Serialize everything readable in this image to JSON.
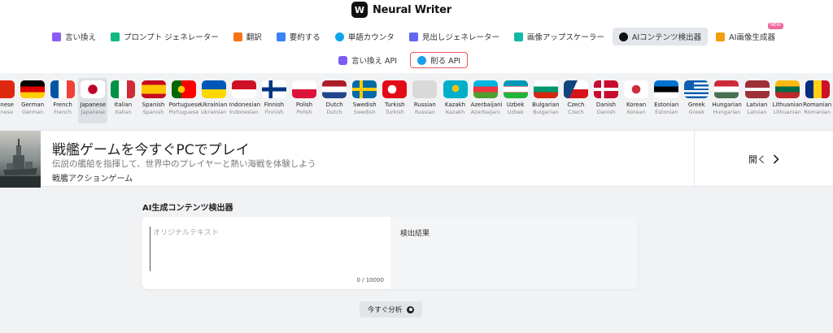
{
  "brand": {
    "name": "Neural Writer",
    "logo_text": "W"
  },
  "nav": {
    "items": [
      {
        "label": "言い換え",
        "icon": "paraphrase-icon",
        "color": "#8b5cf6"
      },
      {
        "label": "プロンプト ジェネレーター",
        "icon": "prompt-icon",
        "color": "#10b981"
      },
      {
        "label": "翻訳",
        "icon": "translate-icon",
        "color": "#f97316"
      },
      {
        "label": "要約する",
        "icon": "summarize-icon",
        "color": "#3b82f6"
      },
      {
        "label": "単語カウンタ",
        "icon": "word-counter-icon",
        "color": "#0ea5e9"
      },
      {
        "label": "見出しジェネレーター",
        "icon": "headline-icon",
        "color": "#6366f1"
      },
      {
        "label": "画像アップスケーラー",
        "icon": "upscaler-icon",
        "color": "#14b8a6"
      },
      {
        "label": "AIコンテンツ検出器",
        "icon": "ai-detector-icon",
        "color": "#111111",
        "active": true
      },
      {
        "label": "AI画像生成器",
        "icon": "image-generator-icon",
        "color": "#f59e0b",
        "badge": "NEW"
      }
    ]
  },
  "api": {
    "paraphrase_api": "言い換え API",
    "delete_api": "削る API"
  },
  "languages": [
    {
      "name": "Chinese",
      "native": "Chinese",
      "flag": "cn"
    },
    {
      "name": "German",
      "native": "German",
      "flag": "de"
    },
    {
      "name": "French",
      "native": "French",
      "flag": "fr"
    },
    {
      "name": "Japanese",
      "native": "Japanese",
      "flag": "jp",
      "selected": true
    },
    {
      "name": "Italian",
      "native": "Italian",
      "flag": "it"
    },
    {
      "name": "Spanish",
      "native": "Spanish",
      "flag": "es"
    },
    {
      "name": "Portuguese",
      "native": "Portuguese",
      "flag": "pt"
    },
    {
      "name": "Ukrainian",
      "native": "Ukrainian",
      "flag": "ua"
    },
    {
      "name": "Indonesian",
      "native": "Indonesian",
      "flag": "id"
    },
    {
      "name": "Finnish",
      "native": "Finnish",
      "flag": "fi"
    },
    {
      "name": "Polish",
      "native": "Polish",
      "flag": "pl"
    },
    {
      "name": "Dutch",
      "native": "Dutch",
      "flag": "nl"
    },
    {
      "name": "Swedish",
      "native": "Swedish",
      "flag": "se"
    },
    {
      "name": "Turkish",
      "native": "Turkish",
      "flag": "tr"
    },
    {
      "name": "Russian",
      "native": "Russian",
      "flag": "ru"
    },
    {
      "name": "Kazakh",
      "native": "Kazakh",
      "flag": "kz"
    },
    {
      "name": "Azerbaijani",
      "native": "Azerbaijani",
      "flag": "az"
    },
    {
      "name": "Uzbek",
      "native": "Uzbek",
      "flag": "uz"
    },
    {
      "name": "Bulgarian",
      "native": "Bulgarian",
      "flag": "bg"
    },
    {
      "name": "Czech",
      "native": "Czech",
      "flag": "cz"
    },
    {
      "name": "Danish",
      "native": "Danish",
      "flag": "dk"
    },
    {
      "name": "Korean",
      "native": "Korean",
      "flag": "kr"
    },
    {
      "name": "Estonian",
      "native": "Estonian",
      "flag": "ee"
    },
    {
      "name": "Greek",
      "native": "Greek",
      "flag": "gr"
    },
    {
      "name": "Hungarian",
      "native": "Hungarian",
      "flag": "hu"
    },
    {
      "name": "Latvian",
      "native": "Latvian",
      "flag": "lv"
    },
    {
      "name": "Lithuanian",
      "native": "Lithuanian",
      "flag": "lt"
    },
    {
      "name": "Romanian",
      "native": "Romanian",
      "flag": "ro"
    }
  ],
  "ad": {
    "title": "戦艦ゲームを今すぐPCでプレイ",
    "description": "伝説の艦船を指揮して、世界中のプレイヤーと熱い海戦を体験しよう",
    "subtitle": "戦艦アクションゲーム",
    "cta": "開く"
  },
  "detector": {
    "title": "AI生成コンテンツ検出器",
    "input_placeholder": "オリジナルテキスト",
    "char_count": "0 / 10000",
    "result_label": "検出結果",
    "analyze_button": "今すぐ分析"
  }
}
